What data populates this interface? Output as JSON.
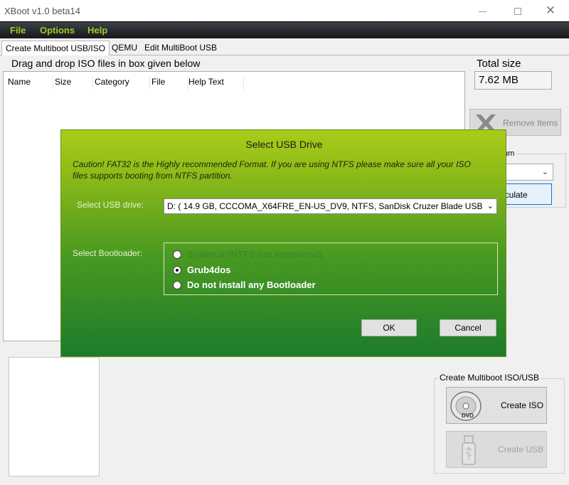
{
  "window": {
    "title": "XBoot v1.0 beta14",
    "minimize_icon": "minimize-icon",
    "maximize_icon": "maximize-icon",
    "close_icon": "close-icon",
    "close_glyph": "✕"
  },
  "menu": {
    "file": "File",
    "options": "Options",
    "help": "Help",
    "accent_color": "#9bcb2a"
  },
  "tabs": [
    {
      "label": "Create Multiboot USB/ISO",
      "active": true
    },
    {
      "label": "QEMU",
      "active": false
    },
    {
      "label": "Edit MultiBoot USB",
      "active": false
    }
  ],
  "main": {
    "drag_label": "Drag and drop ISO files in box given below",
    "columns": [
      "Name",
      "Size",
      "Category",
      "File",
      "Help Text"
    ],
    "total_size_label": "Total size",
    "total_size_value": "7.62 MB",
    "remove_items_label": "Remove Items",
    "frag_label": "um",
    "calculate_label": "lculate",
    "create_group_title": "Create Multiboot ISO/USB",
    "create_iso_label": "Create ISO",
    "create_usb_label": "Create USB"
  },
  "dialog": {
    "title": "Select USB Drive",
    "caution": "Caution! FAT32 is the Highly recommended Format. If you are using NTFS please make sure all your ISO files supports booting from NTFS partition.",
    "usb_drive_label": "Select USB drive:",
    "usb_drive_value": "D:  ( 14.9 GB,  CCCOMA_X64FRE_EN-US_DV9,  NTFS,  SanDisk Cruzer Blade USB",
    "bootloader_label": "Select Bootloader:",
    "bootloaders": [
      {
        "label": "Syslinux (NTFS not supported)",
        "selected": false,
        "disabled": true
      },
      {
        "label": "Grub4dos",
        "selected": true,
        "disabled": false
      },
      {
        "label": "Do not install any Bootloader",
        "selected": false,
        "disabled": false
      }
    ],
    "ok_label": "OK",
    "cancel_label": "Cancel",
    "gradient_top": "#a9cc1a",
    "gradient_bottom": "#1d7b2b"
  }
}
